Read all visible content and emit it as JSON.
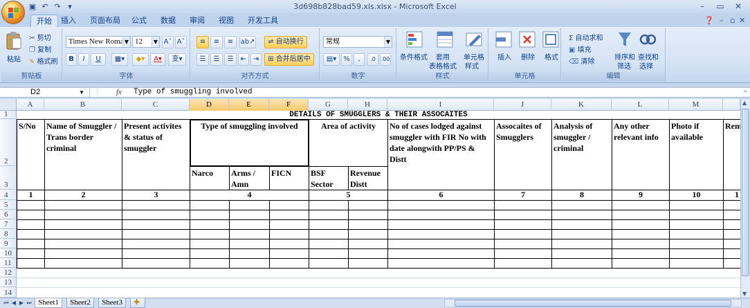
{
  "window": {
    "title": "3d698b828bad59.xls.xlsx - Microsoft Excel",
    "controls": [
      "–",
      "▭",
      "✕"
    ]
  },
  "ribbon_tabs": [
    {
      "label": "开始",
      "active": true
    },
    {
      "label": "插入"
    },
    {
      "label": "页面布局"
    },
    {
      "label": "公式"
    },
    {
      "label": "数据"
    },
    {
      "label": "审阅"
    },
    {
      "label": "视图"
    },
    {
      "label": "开发工具"
    }
  ],
  "clipboard": {
    "paste": "粘贴",
    "cut": "剪切",
    "copy": "复制",
    "format_painter": "格式刷",
    "group": "剪贴板"
  },
  "font": {
    "name": "Times New Roman",
    "size": "12",
    "bold": "B",
    "italic": "I",
    "underline": "U",
    "group": "字体"
  },
  "alignment": {
    "wrap": "自动换行",
    "merge": "合并后居中",
    "group": "对齐方式"
  },
  "number": {
    "format": "常规",
    "percent": "%",
    "comma": ",",
    "group": "数字"
  },
  "styles": {
    "conditional": "条件格式",
    "table_format_1": "套用",
    "table_format_2": "表格格式",
    "cell_style_1": "单元格",
    "cell_style_2": "样式",
    "group": "样式"
  },
  "cells": {
    "insert": "插入",
    "delete": "删除",
    "format": "格式",
    "group": "单元格"
  },
  "editing": {
    "autosum": "Σ 自动求和",
    "fill": "填充",
    "clear": "清除",
    "sort_1": "排序和",
    "sort_2": "筛选",
    "find_1": "查找和",
    "find_2": "选择",
    "group": "编辑"
  },
  "formula_bar": {
    "name_box": "D2",
    "fx": "fx",
    "content": "Type of smuggling involved"
  },
  "columns": [
    "A",
    "B",
    "C",
    "D",
    "E",
    "F",
    "G",
    "H",
    "I",
    "J",
    "K",
    "L",
    "M"
  ],
  "rows": [
    "1",
    "2",
    "3",
    "4",
    "5",
    "6",
    "7",
    "8",
    "9",
    "10",
    "11",
    "12",
    "13",
    "14"
  ],
  "sheet": {
    "title": "DETAILS OF SMUGGLERS & THEIR ASSOCAITES",
    "headers": {
      "a": "S/No",
      "b": "Name of Smuggler / Trans border criminal",
      "c": "Present activites & status of smuggler",
      "d": "Type of smuggling involved",
      "g": "Area of activity",
      "i": "No of cases lodged against smuggler with FIR No with date alongwith PP/PS & Distt",
      "j": "Assocaites of Smugglers",
      "k": "Analysis of smuggler / criminal",
      "l": "Any other relevant info",
      "m": "Photo if available",
      "n": "Rem"
    },
    "subheaders": {
      "d": "Narco",
      "e": "Arms / Amn",
      "f": "FICN",
      "g": "BSF Sector",
      "h": "Revenue Distt"
    },
    "numbers": [
      "1",
      "2",
      "3",
      "4",
      "5",
      "6",
      "7",
      "8",
      "9",
      "10",
      "1"
    ]
  },
  "sheet_tabs": [
    "Sheet1",
    "Sheet2",
    "Sheet3"
  ]
}
